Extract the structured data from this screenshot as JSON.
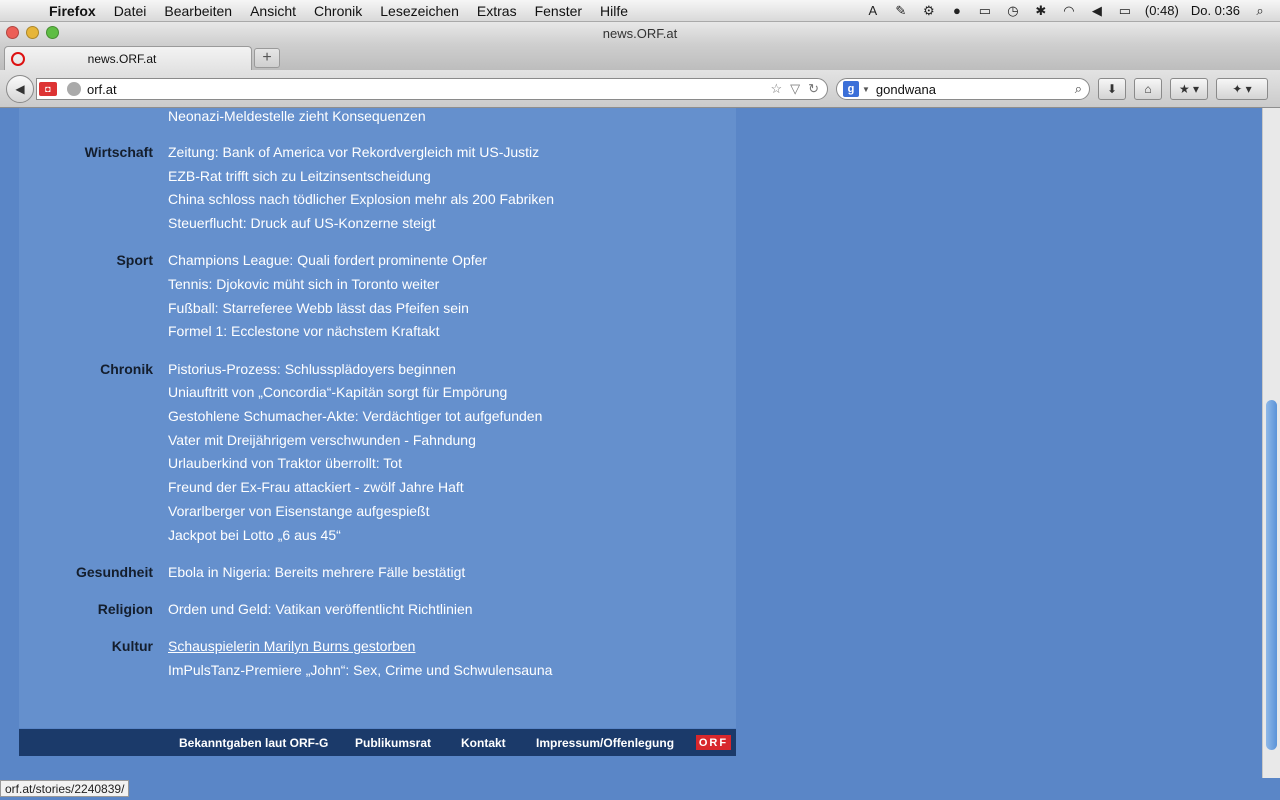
{
  "menubar": {
    "app": "Firefox",
    "items": [
      "Datei",
      "Bearbeiten",
      "Ansicht",
      "Chronik",
      "Lesezeichen",
      "Extras",
      "Fenster",
      "Hilfe"
    ],
    "battery": "(0:48)",
    "clock": "Do. 0:36"
  },
  "window": {
    "title": "news.ORF.at"
  },
  "tab": {
    "label": "news.ORF.at",
    "new_tab": "+"
  },
  "nav": {
    "url": "orf.at",
    "search_engine": "g",
    "search_value": "gondwana"
  },
  "sections": [
    {
      "label": "",
      "items": [
        "Neonazi-Meldestelle zieht Konsequenzen"
      ]
    },
    {
      "label": "Wirtschaft",
      "items": [
        "Zeitung: Bank of America vor Rekordvergleich mit US-Justiz",
        "EZB-Rat trifft sich zu Leitzinsentscheidung",
        "China schloss nach tödlicher Explosion mehr als 200 Fabriken",
        "Steuerflucht: Druck auf US-Konzerne steigt"
      ]
    },
    {
      "label": "Sport",
      "items": [
        "Champions League: Quali fordert prominente Opfer",
        "Tennis: Djokovic müht sich in Toronto weiter",
        "Fußball: Starreferee Webb lässt das Pfeifen sein",
        "Formel 1: Ecclestone vor nächstem Kraftakt"
      ]
    },
    {
      "label": "Chronik",
      "items": [
        "Pistorius-Prozess: Schlussplädoyers beginnen",
        "Uniauftritt von „Concordia“-Kapitän sorgt für Empörung",
        "Gestohlene Schumacher-Akte: Verdächtiger tot aufgefunden",
        "Vater mit Dreijährigem verschwunden - Fahndung",
        "Urlauberkind von Traktor überrollt: Tot",
        "Freund der Ex-Frau attackiert - zwölf Jahre Haft",
        "Vorarlberger von Eisenstange aufgespießt",
        "Jackpot bei Lotto „6 aus 45“"
      ]
    },
    {
      "label": "Gesundheit",
      "items": [
        "Ebola in Nigeria: Bereits mehrere Fälle bestätigt"
      ]
    },
    {
      "label": "Religion",
      "items": [
        "Orden und Geld: Vatikan veröffentlicht Richtlinien"
      ]
    },
    {
      "label": "Kultur",
      "items": [
        "Schauspielerin Marilyn Burns gestorben",
        "ImPulsTanz-Premiere „John“: Sex, Crime und Schwulensauna"
      ]
    }
  ],
  "footer": {
    "links": [
      "Bekanntgaben laut ORF-G",
      "Publikumsrat",
      "Kontakt",
      "Impressum/Offenlegung"
    ],
    "logo": "ORF"
  },
  "status": {
    "hover_url": "orf.at/stories/2240839/"
  }
}
